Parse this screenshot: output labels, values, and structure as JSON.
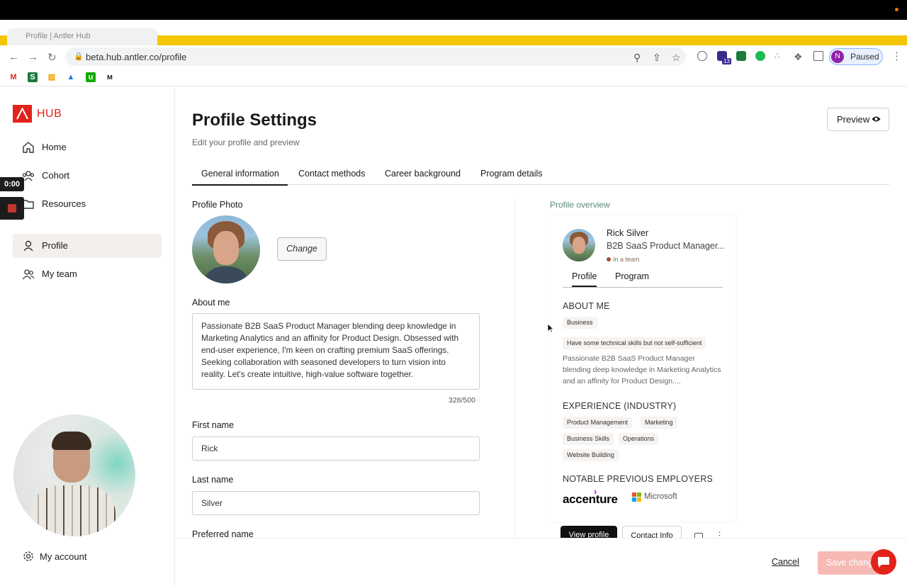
{
  "browser": {
    "tab_title": "Profile | Antler Hub",
    "url": "beta.hub.antler.co/profile",
    "profile_initial": "N",
    "profile_status": "Paused",
    "extension_badge": "13"
  },
  "sidebar": {
    "logo_text": "HUB",
    "items": [
      {
        "label": "Home",
        "icon": "home-icon"
      },
      {
        "label": "Cohort",
        "icon": "cohort-icon"
      },
      {
        "label": "Resources",
        "icon": "folder-icon"
      },
      {
        "label": "Profile",
        "icon": "user-icon"
      },
      {
        "label": "My team",
        "icon": "team-icon"
      }
    ],
    "active": "Profile",
    "account_label": "My account"
  },
  "recorder": {
    "timer": "0:00"
  },
  "page": {
    "title": "Profile Settings",
    "subtitle": "Edit your profile and preview",
    "preview_label": "Preview",
    "tabs": [
      "General information",
      "Contact methods",
      "Career background",
      "Program details"
    ],
    "active_tab": "General information"
  },
  "form": {
    "photo_label": "Profile Photo",
    "change_label": "Change",
    "about_label": "About me",
    "about_text": "Passionate B2B SaaS Product Manager blending deep knowledge in Marketing Analytics and an affinity for Product Design. Obsessed with end-user experience, I'm keen on crafting premium SaaS offerings. Seeking collaboration with seasoned developers to turn vision into reality. Let's create intuitive, high-value software together.",
    "about_counter": "328/500",
    "first_name_label": "First name",
    "first_name_value": "Rick",
    "last_name_label": "Last name",
    "last_name_value": "Silver",
    "preferred_name_label": "Preferred name"
  },
  "overview": {
    "title": "Profile overview",
    "name": "Rick Silver",
    "headline": "B2B SaaS Product Manager...",
    "status": "In a team",
    "tabs": [
      "Profile",
      "Program"
    ],
    "about_heading": "ABOUT ME",
    "about_tags": [
      "Business",
      "Have some technical skills but not self-sufficient"
    ],
    "about_excerpt": "Passionate B2B SaaS Product Manager blending deep knowledge in Marketing Analytics and an affinity for Product Design....",
    "experience_heading": "EXPERIENCE (INDUSTRY)",
    "experience_tags": [
      "Product Management",
      "Marketing",
      "Business Skills",
      "Operations",
      "Website Building"
    ],
    "employers_heading": "NOTABLE PREVIOUS EMPLOYERS",
    "employers": [
      "accenture",
      "Microsoft"
    ],
    "view_profile": "View profile",
    "contact_info": "Contact Info"
  },
  "footer": {
    "cancel_label": "Cancel",
    "save_label": "Save changes"
  },
  "colors": {
    "brand_red": "#e2231a",
    "overview_green": "#5a8a80",
    "save_disabled": "#f6b9b4",
    "active_nav_bg": "#f3efec"
  }
}
